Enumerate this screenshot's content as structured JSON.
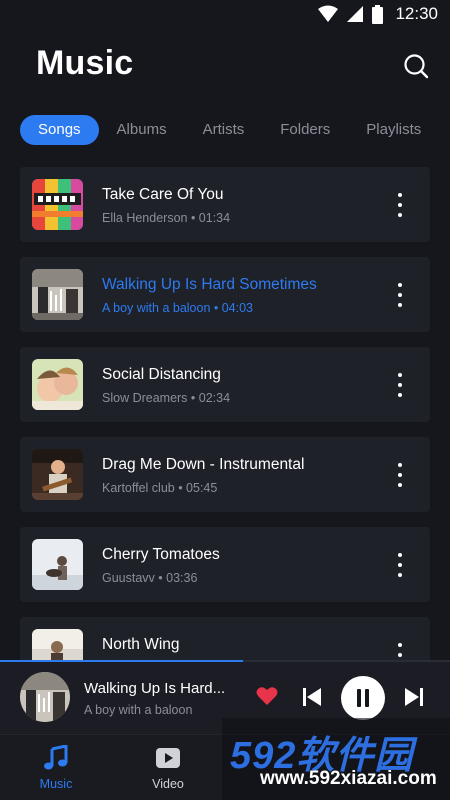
{
  "status": {
    "time": "12:30"
  },
  "header": {
    "title": "Music"
  },
  "tabs": [
    {
      "label": "Songs",
      "active": true
    },
    {
      "label": "Albums"
    },
    {
      "label": "Artists"
    },
    {
      "label": "Folders"
    },
    {
      "label": "Playlists"
    }
  ],
  "songs": [
    {
      "title": "Take Care Of You",
      "subtitle": "Ella Henderson • 01:34",
      "playing": false
    },
    {
      "title": "Walking Up Is Hard Sometimes",
      "subtitle": "A boy with a baloon • 04:03",
      "playing": true
    },
    {
      "title": "Social Distancing",
      "subtitle": "Slow Dreamers • 02:34",
      "playing": false
    },
    {
      "title": "Drag Me Down - Instrumental",
      "subtitle": "Kartoffel club • 05:45",
      "playing": false
    },
    {
      "title": "Cherry Tomatoes",
      "subtitle": "Guustavv • 03:36",
      "playing": false
    },
    {
      "title": "North Wing",
      "subtitle": "",
      "playing": false
    }
  ],
  "player": {
    "title": "Walking Up Is Hard...",
    "subtitle": "A boy with a baloon",
    "progress": 0.54,
    "liked": true
  },
  "nav": [
    {
      "label": "Music",
      "icon": "music-note-icon",
      "active": true
    },
    {
      "label": "Video",
      "icon": "video-play-icon",
      "active": false
    }
  ],
  "watermark": {
    "logo": "592软件园",
    "url": "www.592xiazai.com"
  },
  "colors": {
    "accent": "#2d7bf0",
    "background": "#16171d",
    "card": "#1f2129",
    "heart": "#e8344a"
  }
}
